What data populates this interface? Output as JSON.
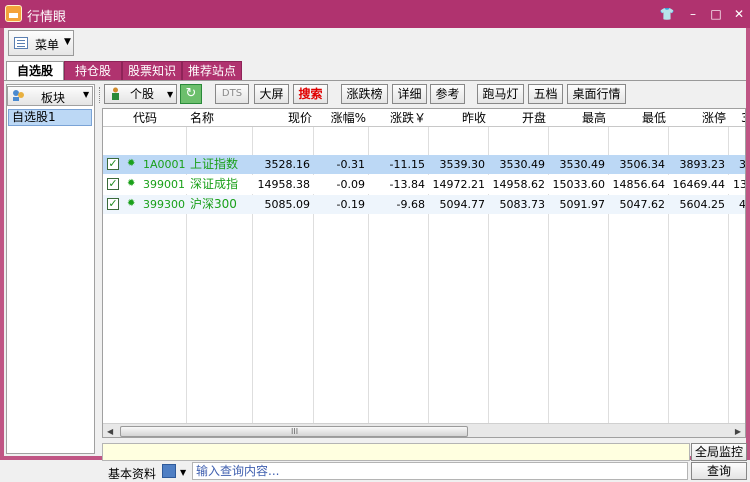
{
  "window": {
    "title": "行情眼"
  },
  "menu": {
    "label": "菜单"
  },
  "tabs": [
    {
      "label": "自选股",
      "active": true
    },
    {
      "label": "持仓股",
      "active": false
    },
    {
      "label": "股票知识",
      "active": false
    },
    {
      "label": "推荐站点",
      "active": false
    }
  ],
  "left_panel": {
    "block_button": "板块",
    "items": [
      "自选股1"
    ]
  },
  "toolbar": {
    "stock_select": "个股",
    "buttons": [
      "DTS",
      "大屏",
      "搜索",
      "涨跌榜",
      "详细",
      "参考",
      "跑马灯",
      "五档",
      "桌面行情"
    ]
  },
  "table": {
    "headers": [
      "代码",
      "名称",
      "现价",
      "涨幅%",
      "涨跌￥",
      "昨收",
      "开盘",
      "最高",
      "最低",
      "涨停",
      "3"
    ],
    "rows": [
      {
        "code": "1A0001",
        "name": "上证指数",
        "price": "3528.16",
        "pct": "-0.31",
        "chg": "-11.15",
        "prev": "3539.30",
        "open": "3530.49",
        "high": "3530.49",
        "low": "3506.34",
        "limit_up": "3893.23",
        "extra": "3"
      },
      {
        "code": "399001",
        "name": "深证成指",
        "price": "14958.38",
        "pct": "-0.09",
        "chg": "-13.84",
        "prev": "14972.21",
        "open": "14958.62",
        "high": "15033.60",
        "low": "14856.64",
        "limit_up": "16469.44",
        "extra": "13"
      },
      {
        "code": "399300",
        "name": "沪深300",
        "price": "5085.09",
        "pct": "-0.19",
        "chg": "-9.68",
        "prev": "5094.77",
        "open": "5083.73",
        "high": "5091.97",
        "low": "5047.62",
        "limit_up": "5604.25",
        "extra": "4"
      }
    ]
  },
  "scrollbar": {
    "grip": "III"
  },
  "bottom": {
    "global_monitor": "全局监控",
    "info_label": "基本资料",
    "query_placeholder": "输入查询内容...",
    "query_button": "查询"
  },
  "colors": {
    "title_bar": "#b0336f",
    "tab_inactive": "#b0336f",
    "selected_row": "#bcd8f5",
    "code_green": "#1aa01a",
    "name_green": "#1aa01a",
    "search_red": "#e00000"
  }
}
